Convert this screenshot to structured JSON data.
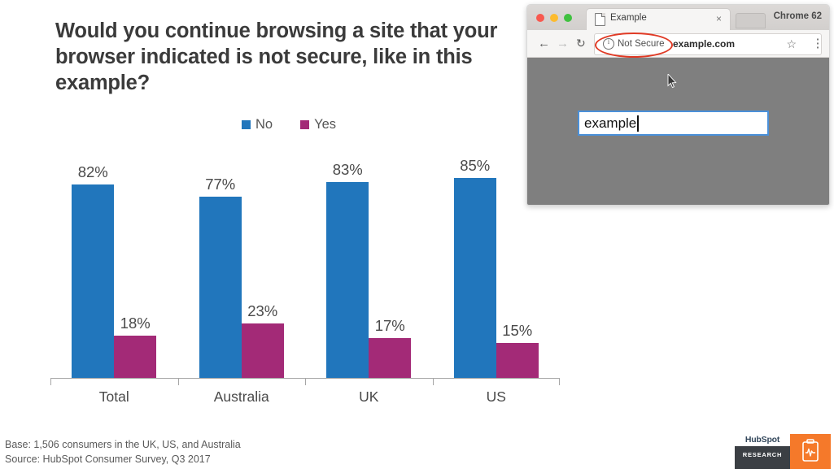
{
  "slide": {
    "title": "Would you continue browsing a site that your browser indicated is not secure, like in this example?"
  },
  "chart_data": {
    "type": "bar",
    "title": "Would you continue browsing a site that your browser indicated is not secure, like in this example?",
    "categories": [
      "Total",
      "Australia",
      "UK",
      "US"
    ],
    "series": [
      {
        "name": "No",
        "color": "#2176bc",
        "values": [
          82,
          77,
          83,
          85
        ],
        "labels": [
          "82%",
          "77%",
          "83%",
          "85%"
        ]
      },
      {
        "name": "Yes",
        "color": "#a32a77",
        "values": [
          18,
          23,
          17,
          15
        ],
        "labels": [
          "18%",
          "23%",
          "17%",
          "15%"
        ]
      }
    ],
    "xlabel": "",
    "ylabel": "",
    "ylim": [
      0,
      100
    ],
    "grid": false,
    "legend_position": "top-center",
    "value_suffix": "%"
  },
  "legend": {
    "items": [
      {
        "label": "No",
        "color": "#2176bc"
      },
      {
        "label": "Yes",
        "color": "#a32a77"
      }
    ]
  },
  "footer": {
    "base": "Base: 1,506 consumers in the UK, US, and Australia",
    "source": "Source: HubSpot Consumer Survey, Q3 2017"
  },
  "logo": {
    "wordmark": "HubSpot",
    "research": "RESEARCH",
    "dark_color": "#3b3f44",
    "orange_color": "#f5792a"
  },
  "browser": {
    "tab": {
      "title": "Example",
      "close_label": "×"
    },
    "version_label": "Chrome 62",
    "toolbar": {
      "back_icon": "←",
      "forward_icon": "→",
      "reload_icon": "↻",
      "security_status": "Not Secure",
      "url": "example.com",
      "star_icon": "☆",
      "menu_icon": "⋮",
      "highlight_color": "#e03a25"
    },
    "page": {
      "input_value": "example",
      "background_color": "#7f7f7f",
      "focus_border_color": "#4a90d9"
    },
    "window_controls": {
      "close_color": "#f8594f",
      "minimize_color": "#fcbb2e",
      "zoom_color": "#3fc13f"
    }
  }
}
